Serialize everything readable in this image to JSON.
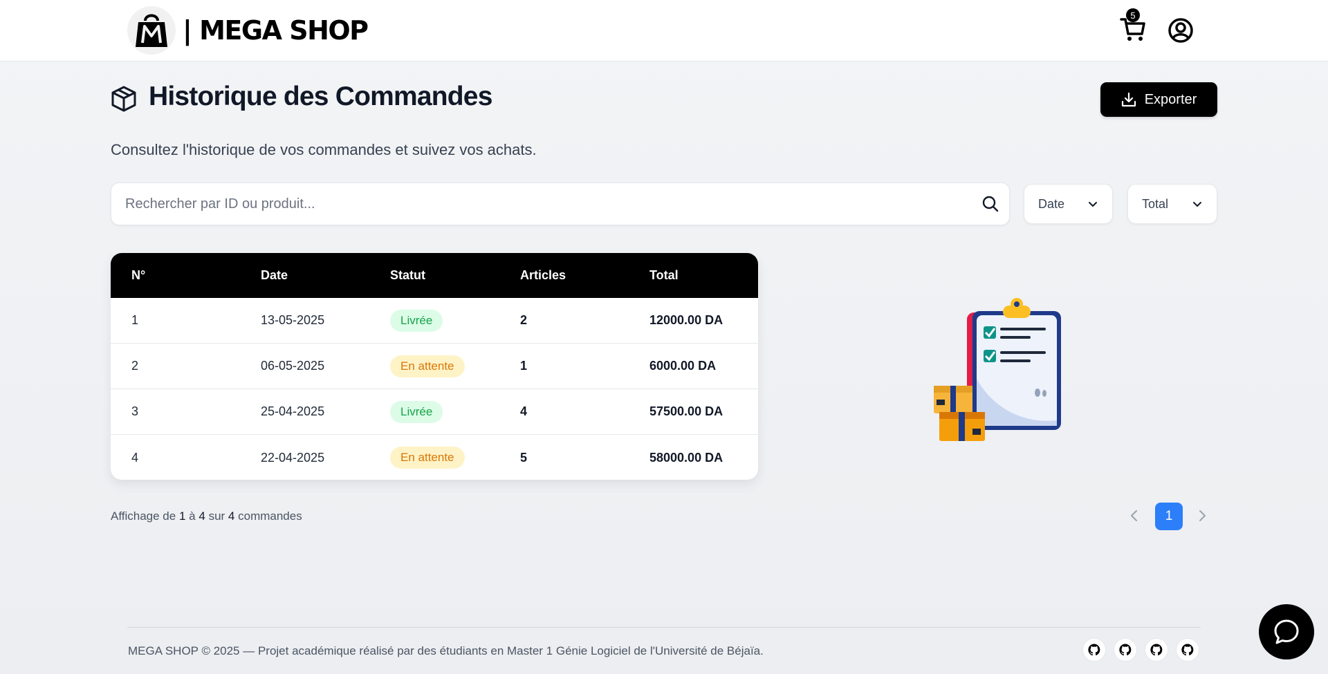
{
  "header": {
    "brand": "| MEGA SHOP",
    "cart_count": "5",
    "icons": {
      "logo": "bag-m-logo",
      "cart": "cart-icon",
      "user": "user-circle-icon"
    }
  },
  "page": {
    "title": "Historique des Commandes",
    "subtitle": "Consultez l'historique de vos commandes et suivez vos achats.",
    "export_label": "Exporter"
  },
  "search": {
    "placeholder": "Rechercher par ID ou produit..."
  },
  "filters": {
    "date_label": "Date",
    "total_label": "Total"
  },
  "table": {
    "headers": [
      "N°",
      "Date",
      "Statut",
      "Articles",
      "Total"
    ],
    "rows": [
      {
        "id": "1",
        "date": "13-05-2025",
        "status": "Livrée",
        "status_type": "delivered",
        "articles": "2",
        "total": "12000.00 DA"
      },
      {
        "id": "2",
        "date": "06-05-2025",
        "status": "En attente",
        "status_type": "pending",
        "articles": "1",
        "total": "6000.00 DA"
      },
      {
        "id": "3",
        "date": "25-04-2025",
        "status": "Livrée",
        "status_type": "delivered",
        "articles": "4",
        "total": "57500.00 DA"
      },
      {
        "id": "4",
        "date": "22-04-2025",
        "status": "En attente",
        "status_type": "pending",
        "articles": "5",
        "total": "58000.00 DA"
      }
    ]
  },
  "pagination": {
    "prefix": "Affichage de",
    "from": "1",
    "sep1": "à",
    "to": "4",
    "sep2": "sur",
    "count": "4",
    "suffix": "commandes",
    "current_page": "1"
  },
  "footer": {
    "text": "MEGA SHOP © 2025 — Projet académique réalisé par des étudiants en Master 1 Génie Logiciel de l'Université de Béjaïa."
  },
  "colors": {
    "accent": "#2d7ff9",
    "primary": "#000000",
    "delivered_bg": "#dcfce7",
    "delivered_fg": "#16a34a",
    "pending_bg": "#fef3c7",
    "pending_fg": "#d97706"
  }
}
